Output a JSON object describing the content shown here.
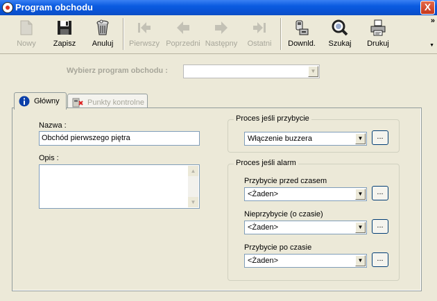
{
  "window": {
    "title": "Program obchodu",
    "close_label": "X"
  },
  "toolbar": {
    "buttons": [
      {
        "label": "Nowy",
        "icon": "new-document-icon",
        "enabled": false
      },
      {
        "label": "Zapisz",
        "icon": "floppy-disk-icon",
        "enabled": true
      },
      {
        "label": "Anuluj",
        "icon": "trash-bin-icon",
        "enabled": true
      },
      {
        "label": "Pierwszy",
        "icon": "first-record-icon",
        "enabled": false
      },
      {
        "label": "Poprzedni",
        "icon": "previous-arrow-icon",
        "enabled": false
      },
      {
        "label": "Następny",
        "icon": "next-arrow-icon",
        "enabled": false
      },
      {
        "label": "Ostatni",
        "icon": "last-record-icon",
        "enabled": false
      },
      {
        "label": "Downld.",
        "icon": "download-device-icon",
        "enabled": true
      },
      {
        "label": "Szukaj",
        "icon": "search-magnifier-icon",
        "enabled": true
      },
      {
        "label": "Drukuj",
        "icon": "printer-icon",
        "enabled": true
      }
    ],
    "overflow_label": "»",
    "dropdown_label": "▼"
  },
  "selector": {
    "label": "Wybierz program obchodu :",
    "value": ""
  },
  "tabs": [
    {
      "label": "Główny",
      "icon": "info-icon",
      "active": true
    },
    {
      "label": "Punkty kontrolne",
      "icon": "checkpoint-icon",
      "active": false
    }
  ],
  "form": {
    "name_label": "Nazwa :",
    "name_value": "Obchód pierwszego piętra",
    "description_label": "Opis :",
    "description_value": ""
  },
  "arrival_group": {
    "title": "Proces jeśli przybycie",
    "value": "Włączenie buzzera",
    "button_label": "..."
  },
  "alarm_group": {
    "title": "Proces jeśli alarm",
    "rows": [
      {
        "label": "Przybycie przed czasem",
        "value": "<Żaden>",
        "button_label": "..."
      },
      {
        "label": "Nieprzybycie (o czasie)",
        "value": "<Żaden>",
        "button_label": "..."
      },
      {
        "label": "Przybycie po czasie",
        "value": "<Żaden>",
        "button_label": "..."
      }
    ]
  },
  "colors": {
    "titlebar": "#0a5be0",
    "face": "#ece9d8",
    "disabled_text": "#a7a69a"
  }
}
